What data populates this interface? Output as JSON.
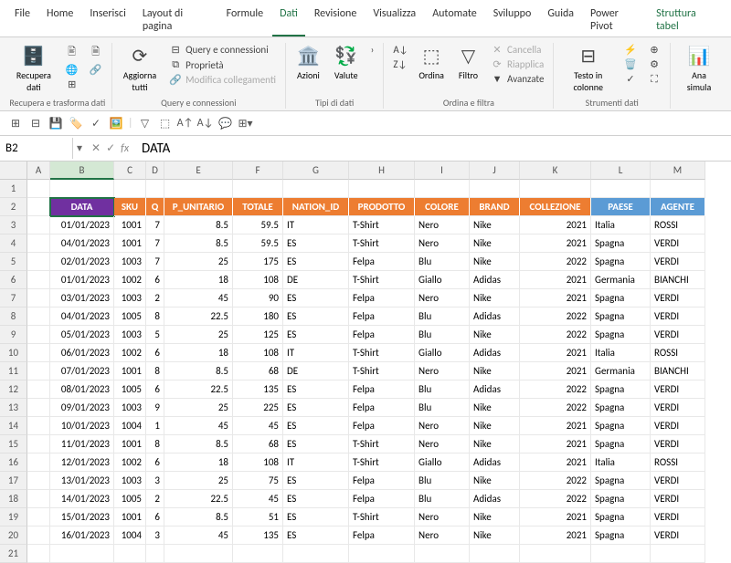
{
  "tabs": [
    "File",
    "Home",
    "Inserisci",
    "Layout di pagina",
    "Formule",
    "Dati",
    "Revisione",
    "Visualizza",
    "Automate",
    "Sviluppo",
    "Guida",
    "Power Pivot",
    "Struttura tabel"
  ],
  "active_tab": "Dati",
  "ribbon": {
    "g1": {
      "btn": "Recupera\ndati",
      "label": "Recupera e trasforma dati"
    },
    "g2": {
      "btn": "Aggiorna\ntutti",
      "a": "Query e connessioni",
      "b": "Proprietà",
      "c": "Modifica collegamenti",
      "label": "Query e connessioni"
    },
    "g3": {
      "a": "Azioni",
      "b": "Valute",
      "label": "Tipi di dati"
    },
    "g4": {
      "a": "Ordina",
      "b": "Filtro",
      "c": "Cancella",
      "d": "Riapplica",
      "e": "Avanzate",
      "label": "Ordina e filtra"
    },
    "g5": {
      "btn": "Testo in\ncolonne",
      "label": "Strumenti dati"
    },
    "g6": {
      "btn": "Ana\nsimula"
    }
  },
  "namebox": "B2",
  "formula": "DATA",
  "cols": [
    "A",
    "B",
    "C",
    "D",
    "E",
    "F",
    "G",
    "H",
    "I",
    "J",
    "K",
    "L",
    "M"
  ],
  "header": [
    "",
    "DATA",
    "SKU",
    "Q",
    "P_UNITARIO",
    "TOTALE",
    "NATION_ID",
    "PRODOTTO",
    "COLORE",
    "BRAND",
    "COLLEZIONE",
    "PAESE",
    "AGENTE"
  ],
  "header_colors": [
    "",
    "purple",
    "orange",
    "orange",
    "orange",
    "orange",
    "orange",
    "orange",
    "orange",
    "orange",
    "orange",
    "blue",
    "blue"
  ],
  "chart_data": {
    "type": "table",
    "columns": [
      "DATA",
      "SKU",
      "Q",
      "P_UNITARIO",
      "TOTALE",
      "NATION_ID",
      "PRODOTTO",
      "COLORE",
      "BRAND",
      "COLLEZIONE",
      "PAESE",
      "AGENTE"
    ],
    "rows": [
      [
        "01/01/2023",
        "1001",
        "7",
        "8.5",
        "59.5",
        "IT",
        "T-Shirt",
        "Nero",
        "Nike",
        "2021",
        "Italia",
        "ROSSI"
      ],
      [
        "04/01/2023",
        "1001",
        "7",
        "8.5",
        "59.5",
        "ES",
        "T-Shirt",
        "Nero",
        "Nike",
        "2021",
        "Spagna",
        "VERDI"
      ],
      [
        "02/01/2023",
        "1003",
        "7",
        "25",
        "175",
        "ES",
        "Felpa",
        "Blu",
        "Nike",
        "2022",
        "Spagna",
        "VERDI"
      ],
      [
        "01/01/2023",
        "1002",
        "6",
        "18",
        "108",
        "DE",
        "T-Shirt",
        "Giallo",
        "Adidas",
        "2021",
        "Germania",
        "BIANCHI"
      ],
      [
        "03/01/2023",
        "1003",
        "2",
        "45",
        "90",
        "ES",
        "Felpa",
        "Nero",
        "Nike",
        "2021",
        "Spagna",
        "VERDI"
      ],
      [
        "04/01/2023",
        "1005",
        "8",
        "22.5",
        "180",
        "ES",
        "Felpa",
        "Blu",
        "Adidas",
        "2022",
        "Spagna",
        "VERDI"
      ],
      [
        "05/01/2023",
        "1003",
        "5",
        "25",
        "125",
        "ES",
        "Felpa",
        "Blu",
        "Nike",
        "2022",
        "Spagna",
        "VERDI"
      ],
      [
        "06/01/2023",
        "1002",
        "6",
        "18",
        "108",
        "IT",
        "T-Shirt",
        "Giallo",
        "Adidas",
        "2021",
        "Italia",
        "ROSSI"
      ],
      [
        "07/01/2023",
        "1001",
        "8",
        "8.5",
        "68",
        "DE",
        "T-Shirt",
        "Nero",
        "Nike",
        "2021",
        "Germania",
        "BIANCHI"
      ],
      [
        "08/01/2023",
        "1005",
        "6",
        "22.5",
        "135",
        "ES",
        "Felpa",
        "Blu",
        "Adidas",
        "2022",
        "Spagna",
        "VERDI"
      ],
      [
        "09/01/2023",
        "1003",
        "9",
        "25",
        "225",
        "ES",
        "Felpa",
        "Blu",
        "Nike",
        "2022",
        "Spagna",
        "VERDI"
      ],
      [
        "10/01/2023",
        "1004",
        "1",
        "45",
        "45",
        "ES",
        "Felpa",
        "Nero",
        "Nike",
        "2021",
        "Spagna",
        "VERDI"
      ],
      [
        "11/01/2023",
        "1001",
        "8",
        "8.5",
        "68",
        "ES",
        "T-Shirt",
        "Nero",
        "Nike",
        "2021",
        "Spagna",
        "VERDI"
      ],
      [
        "12/01/2023",
        "1002",
        "6",
        "18",
        "108",
        "IT",
        "T-Shirt",
        "Giallo",
        "Adidas",
        "2021",
        "Italia",
        "ROSSI"
      ],
      [
        "13/01/2023",
        "1003",
        "3",
        "25",
        "75",
        "ES",
        "Felpa",
        "Blu",
        "Nike",
        "2022",
        "Spagna",
        "VERDI"
      ],
      [
        "14/01/2023",
        "1005",
        "2",
        "22.5",
        "45",
        "ES",
        "Felpa",
        "Blu",
        "Adidas",
        "2022",
        "Spagna",
        "VERDI"
      ],
      [
        "15/01/2023",
        "1001",
        "6",
        "8.5",
        "51",
        "ES",
        "T-Shirt",
        "Nero",
        "Nike",
        "2021",
        "Spagna",
        "VERDI"
      ],
      [
        "16/01/2023",
        "1004",
        "3",
        "45",
        "135",
        "ES",
        "Felpa",
        "Nero",
        "Nike",
        "2021",
        "Spagna",
        "VERDI"
      ]
    ]
  }
}
